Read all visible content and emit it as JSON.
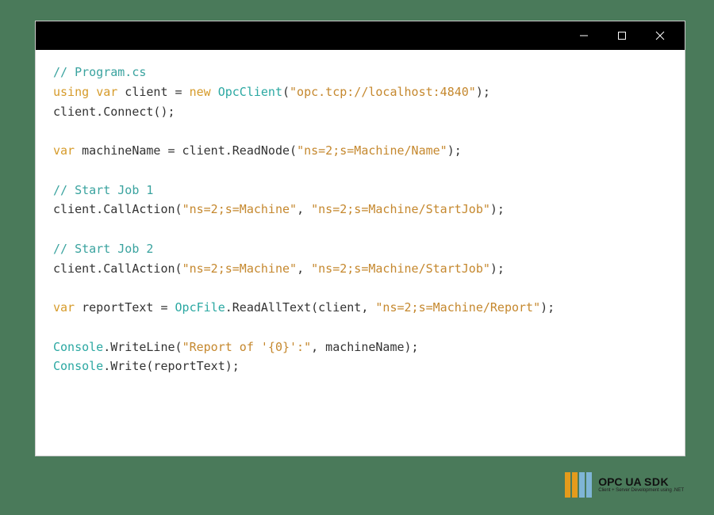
{
  "code": {
    "c1": "// Program.cs",
    "l2a": "using",
    "l2b": "var",
    "l2c": " client = ",
    "l2d": "new",
    "l2e": " ",
    "l2f": "OpcClient",
    "l2g": "(",
    "l2h": "\"opc.tcp://localhost:4840\"",
    "l2i": ");",
    "l3": "client.Connect();",
    "l5a": "var",
    "l5b": " machineName = client.ReadNode(",
    "l5c": "\"ns=2;s=Machine/Name\"",
    "l5d": ");",
    "c7": "// Start Job 1",
    "l8a": "client.CallAction(",
    "l8b": "\"ns=2;s=Machine\"",
    "l8c": ", ",
    "l8d": "\"ns=2;s=Machine/StartJob\"",
    "l8e": ");",
    "c10": "// Start Job 2",
    "l11a": "client.CallAction(",
    "l11b": "\"ns=2;s=Machine\"",
    "l11c": ", ",
    "l11d": "\"ns=2;s=Machine/StartJob\"",
    "l11e": ");",
    "l13a": "var",
    "l13b": " reportText = ",
    "l13c": "OpcFile",
    "l13d": ".ReadAllText(client, ",
    "l13e": "\"ns=2;s=Machine/Report\"",
    "l13f": ");",
    "l15a": "Console",
    "l15b": ".WriteLine(",
    "l15c": "\"Report of '{0}':\"",
    "l15d": ", machineName);",
    "l16a": "Console",
    "l16b": ".Write(reportText);"
  },
  "logo": {
    "main": "OPC UA ",
    "sdk": "SDK",
    "sub": "Client + Server Development using .NET"
  }
}
